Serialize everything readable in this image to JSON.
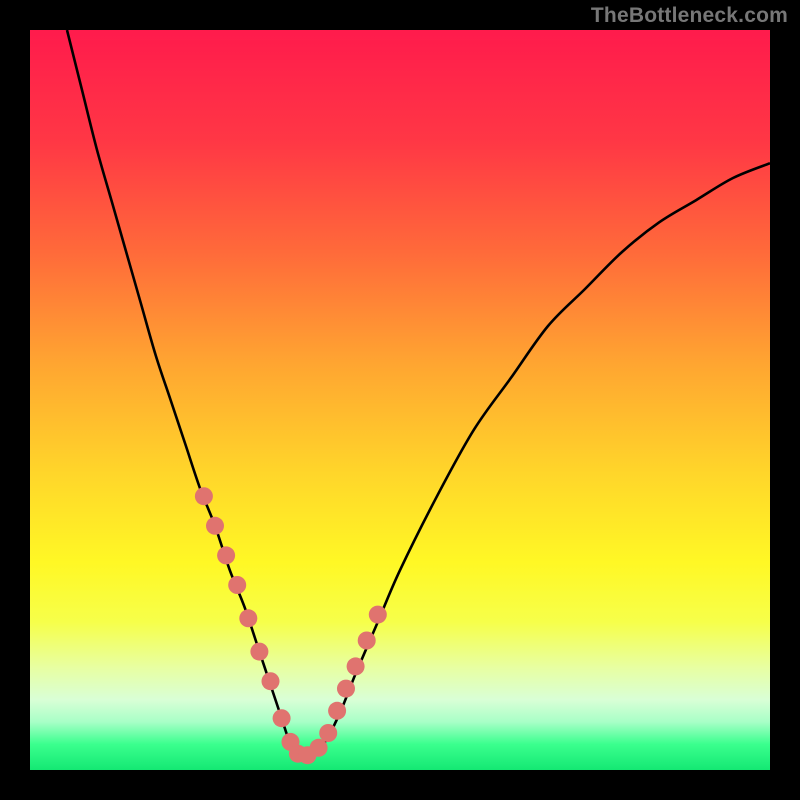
{
  "watermark": "TheBottleneck.com",
  "colors": {
    "curve_stroke": "#000000",
    "marker_fill": "#e0736f",
    "marker_stroke": "#c9605c"
  },
  "chart_data": {
    "type": "line",
    "title": "",
    "xlabel": "",
    "ylabel": "",
    "xlim": [
      0,
      100
    ],
    "ylim": [
      0,
      100
    ],
    "gradient_stops": [
      {
        "offset": 0.0,
        "color": "#ff1b4c"
      },
      {
        "offset": 0.15,
        "color": "#ff3745"
      },
      {
        "offset": 0.3,
        "color": "#ff6a3a"
      },
      {
        "offset": 0.45,
        "color": "#ffa531"
      },
      {
        "offset": 0.6,
        "color": "#ffd62a"
      },
      {
        "offset": 0.72,
        "color": "#fff825"
      },
      {
        "offset": 0.8,
        "color": "#f6ff4a"
      },
      {
        "offset": 0.86,
        "color": "#e8ffa0"
      },
      {
        "offset": 0.905,
        "color": "#d9ffd6"
      },
      {
        "offset": 0.935,
        "color": "#a8ffc7"
      },
      {
        "offset": 0.965,
        "color": "#3bff8e"
      },
      {
        "offset": 1.0,
        "color": "#14e873"
      }
    ],
    "series": [
      {
        "name": "bottleneck-curve",
        "x": [
          5,
          7,
          9,
          11,
          13,
          15,
          17,
          19,
          21,
          23,
          25,
          27,
          29,
          31,
          33,
          34,
          35,
          36,
          38,
          40,
          42,
          44,
          47,
          50,
          55,
          60,
          65,
          70,
          75,
          80,
          85,
          90,
          95,
          100
        ],
        "y": [
          100,
          92,
          84,
          77,
          70,
          63,
          56,
          50,
          44,
          38,
          33,
          27,
          22,
          16,
          10,
          7,
          4,
          2,
          2,
          4,
          8,
          13,
          20,
          27,
          37,
          46,
          53,
          60,
          65,
          70,
          74,
          77,
          80,
          82
        ]
      }
    ],
    "markers": {
      "series": "bottleneck-curve",
      "points_x": [
        23.5,
        25,
        26.5,
        28,
        29.5,
        31,
        32.5,
        34,
        35.2,
        36.2,
        37.5,
        39,
        40.3,
        41.5,
        42.7,
        44,
        45.5,
        47
      ],
      "points_y": [
        37,
        33,
        29,
        25,
        20.5,
        16,
        12,
        7,
        3.8,
        2.2,
        2,
        3,
        5,
        8,
        11,
        14,
        17.5,
        21
      ],
      "radius_px": 9
    }
  }
}
